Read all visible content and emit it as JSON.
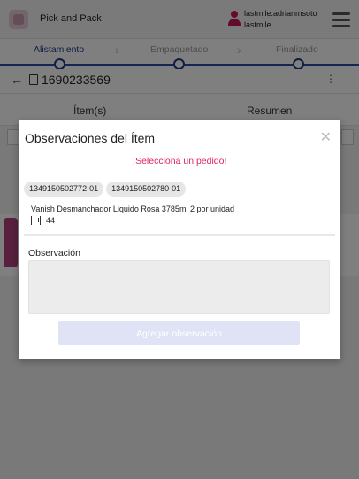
{
  "app": {
    "title": "Pick and Pack",
    "user_name": "lastmile.adrianmsoto",
    "user_role": "lastmile"
  },
  "steps": [
    {
      "label": "Alistamiento",
      "active": true
    },
    {
      "label": "Empaquetado",
      "active": false
    },
    {
      "label": "Finalizado",
      "active": false
    }
  ],
  "order": {
    "number": "1690233569"
  },
  "tabs": [
    {
      "label": "Ítem(s)"
    },
    {
      "label": "Resumen"
    }
  ],
  "modal": {
    "title": "Observaciones del Ítem",
    "warning": "¡Selecciona un pedido!",
    "chips": [
      "1349150502772-01",
      "1349150502780-01"
    ],
    "product_name": "Vanish Desmanchador Liquido Rosa 3785ml 2 por unidad",
    "quantity": "44",
    "observation_label": "Observación",
    "observation_value": "",
    "add_button_label": "Agregar observación"
  },
  "colors": {
    "primary": "#1e3a8a",
    "warning": "#e0245e",
    "brand": "#c2185b"
  },
  "icons": [
    "user-icon",
    "menu-icon",
    "back-arrow-icon",
    "document-icon",
    "kebab-icon",
    "close-icon",
    "barcode-icon"
  ]
}
